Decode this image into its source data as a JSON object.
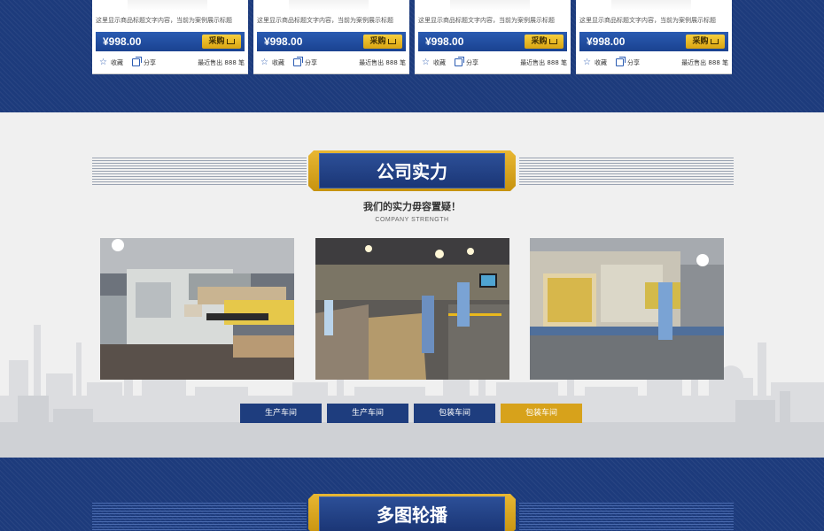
{
  "products": [
    {
      "desc": "这里显示商品标题文字内容，当前为案例展示标题",
      "price": "¥998.00",
      "buy_label": "采购",
      "fav_label": "收藏",
      "share_label": "分享",
      "sold_text": "最近售出 888 笔"
    },
    {
      "desc": "这里显示商品标题文字内容，当前为案例展示标题",
      "price": "¥998.00",
      "buy_label": "采购",
      "fav_label": "收藏",
      "share_label": "分享",
      "sold_text": "最近售出 888 笔"
    },
    {
      "desc": "这里显示商品标题文字内容，当前为案例展示标题",
      "price": "¥998.00",
      "buy_label": "采购",
      "fav_label": "收藏",
      "share_label": "分享",
      "sold_text": "最近售出 888 笔"
    },
    {
      "desc": "这里显示商品标题文字内容，当前为案例展示标题",
      "price": "¥998.00",
      "buy_label": "采购",
      "fav_label": "收藏",
      "share_label": "分享",
      "sold_text": "最近售出 888 笔"
    }
  ],
  "strength": {
    "title": "公司实力",
    "subtitle": "我们的实力毋容置疑！",
    "subtitle_en": "COMPANY STRENGTH",
    "tabs": [
      {
        "label": "生产车间",
        "active": false
      },
      {
        "label": "生产车间",
        "active": false
      },
      {
        "label": "包装车间",
        "active": false
      },
      {
        "label": "包装车间",
        "active": true
      }
    ]
  },
  "carousel": {
    "title": "多图轮播"
  },
  "colors": {
    "navy": "#1d3b7c",
    "gold": "#d7a21b",
    "section_bg": "#f0f0f0"
  }
}
